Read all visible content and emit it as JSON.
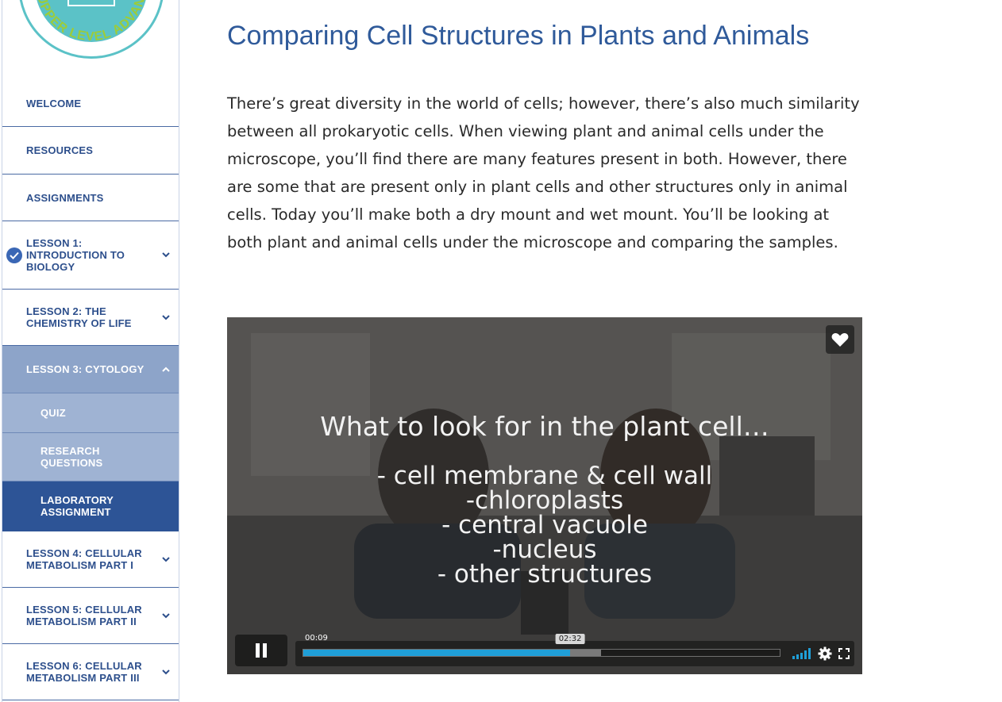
{
  "logo": {
    "text": "UPPER LEVEL ADVANCED"
  },
  "sidebar": {
    "items": [
      {
        "label": "WELCOME"
      },
      {
        "label": "RESOURCES"
      },
      {
        "label": "ASSIGNMENTS"
      },
      {
        "label": "LESSON 1: INTRODUCTION TO BIOLOGY",
        "completed": true
      },
      {
        "label": "LESSON 2: THE CHEMISTRY OF LIFE"
      },
      {
        "label": "LESSON 3: CYTOLOGY",
        "expanded": true,
        "children": [
          {
            "label": "QUIZ"
          },
          {
            "label": "RESEARCH QUESTIONS"
          },
          {
            "label": "LABORATORY ASSIGNMENT",
            "active": true
          }
        ]
      },
      {
        "label": "LESSON 4: CELLULAR METABOLISM PART I"
      },
      {
        "label": "LESSON 5: CELLULAR METABOLISM PART II"
      },
      {
        "label": "LESSON 6: CELLULAR METABOLISM PART III"
      }
    ]
  },
  "main": {
    "title": "Comparing Cell Structures in Plants and Animals",
    "intro": "There’s great diversity in the world of cells; however, there’s also much similarity between all prokaryotic cells. When viewing plant and animal cells under the microscope, you’ll find there are many features present in both. However, there are some that are present only in plant cells and other structures only in animal cells. Today you’ll make both a dry mount and wet mount. You’ll be looking at both plant and animal cells under the microscope and comparing the samples."
  },
  "video": {
    "caption_title": "What to look for in the plant cell…",
    "caption_lines": [
      "- cell membrane & cell wall",
      "-chloroplasts",
      "- central vacuole",
      "-nucleus",
      "- other structures"
    ],
    "current_time": "00:09",
    "hover_time": "02:32",
    "played_fraction": 0.56,
    "buffered_fraction": 0.625,
    "state": "playing"
  },
  "colors": {
    "nav_text": "#2d4f8c",
    "nav_open_bg": "#8da4c9",
    "nav_sub_bg": "#9fb3d3",
    "nav_active_bg": "#2d5496",
    "title": "#2f5a9a",
    "progress": "#1f9fd8",
    "logo": "#5bc2c7"
  },
  "icons": {
    "chevron": "chevron-down-icon",
    "check": "check-circle-icon",
    "like": "heart-icon",
    "pause": "pause-icon",
    "volume": "volume-bars-icon",
    "settings": "gear-icon",
    "fullscreen": "fullscreen-icon"
  }
}
